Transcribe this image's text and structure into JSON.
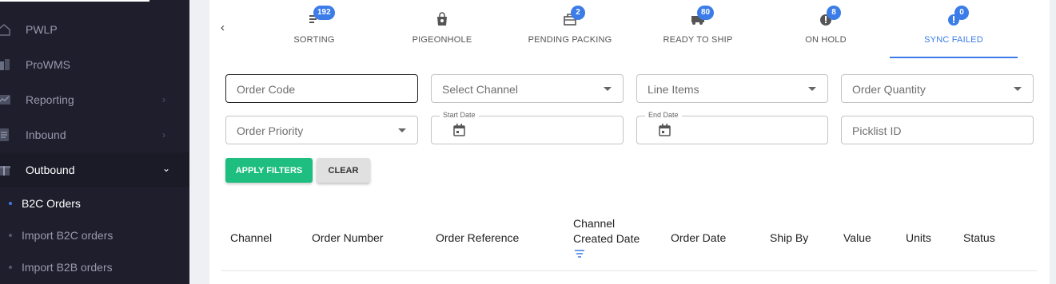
{
  "sidebar": {
    "items": [
      {
        "label": "PWLP",
        "icon": "home-icon"
      },
      {
        "label": "ProWMS",
        "icon": "buildings-icon"
      },
      {
        "label": "Reporting",
        "icon": "chart-icon",
        "chevron": "›"
      },
      {
        "label": "Inbound",
        "icon": "document-icon",
        "chevron": "›"
      },
      {
        "label": "Outbound",
        "icon": "gift-icon",
        "chevron": "⌄"
      }
    ],
    "sub_items": [
      {
        "label": "B2C Orders"
      },
      {
        "label": "Import B2C orders"
      },
      {
        "label": "Import B2B orders"
      }
    ]
  },
  "tabs": {
    "back": "‹",
    "items": [
      {
        "label": "SORTING",
        "badge": "192",
        "icon": "sort-icon"
      },
      {
        "label": "PIGEONHOLE",
        "badge": "",
        "icon": "bag-icon"
      },
      {
        "label": "PENDING PACKING",
        "badge": "2",
        "icon": "box-icon"
      },
      {
        "label": "READY TO SHIP",
        "badge": "80",
        "icon": "truck-icon"
      },
      {
        "label": "ON HOLD",
        "badge": "8",
        "icon": "alert-icon"
      },
      {
        "label": "SYNC FAILED",
        "badge": "0",
        "icon": "alert-icon",
        "active": true
      }
    ]
  },
  "filters": {
    "order_code": "Order Code",
    "channel": "Select Channel",
    "line_items": "Line Items",
    "order_quantity": "Order Quantity",
    "order_priority": "Order Priority",
    "start_date": "Start Date",
    "end_date": "End Date",
    "picklist_id": "Picklist ID",
    "apply_label": "APPLY FILTERS",
    "clear_label": "CLEAR"
  },
  "table": {
    "columns": [
      "Channel",
      "Order Number",
      "Order Reference",
      "Channel",
      "Created Date",
      "Order Date",
      "Ship By",
      "Value",
      "Units",
      "Status"
    ]
  },
  "colors": {
    "accent": "#3b7ce8",
    "primary_button": "#1dbe7f",
    "sidebar_bg": "#1e1e2d"
  }
}
